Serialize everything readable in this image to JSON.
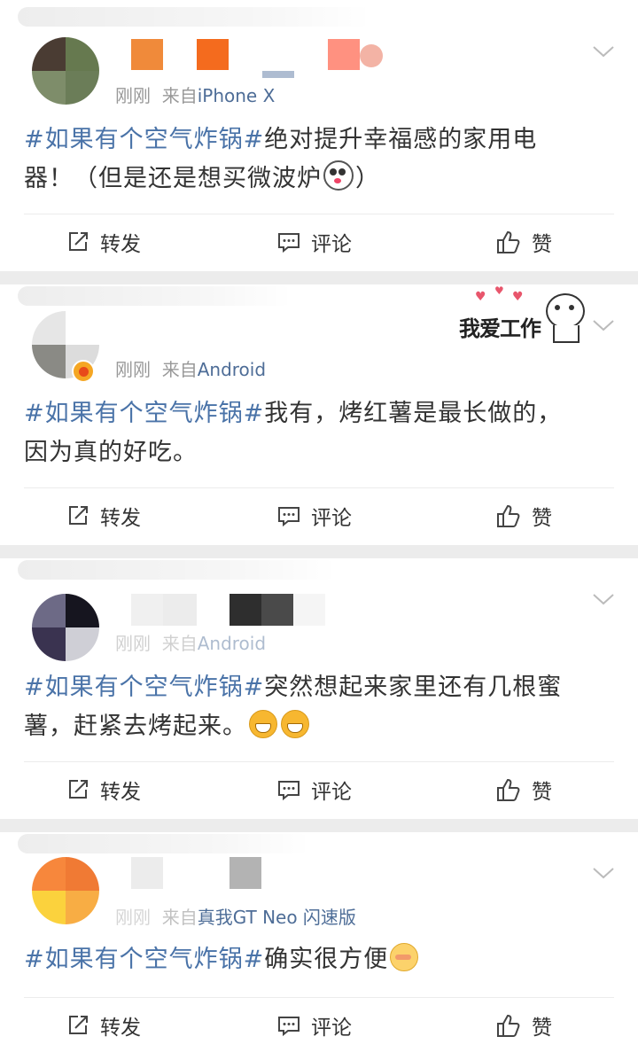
{
  "posts": [
    {
      "time": "刚刚",
      "source_prefix": "来自",
      "source": "iPhone X",
      "topic": "#如果有个空气炸锅#",
      "text_before_emoji": "绝对提升幸福感的家用电器！（但是还是想买微波炉",
      "emoji": [
        "panda-face-emoji"
      ],
      "text_after_emoji": "）"
    },
    {
      "time": "刚刚",
      "source_prefix": "来自",
      "source": "Android",
      "topic": "#如果有个空气炸锅#",
      "text": "我有，烤红薯是最长做的，因为真的好吃。",
      "badge": "verified-badge",
      "sticker_text": "我爱工作"
    },
    {
      "time": "刚刚",
      "source_prefix": "来自",
      "source": "Android",
      "topic": "#如果有个空气炸锅#",
      "text": "突然想起来家里还有几根蜜薯，赶紧去烤起来。",
      "emoji": [
        "grin-emoji",
        "grin-emoji"
      ]
    },
    {
      "time": "刚刚",
      "source_prefix": "来自",
      "source": "真我GT Neo 闪速版",
      "topic": "#如果有个空气炸锅#",
      "text": "确实很方便",
      "emoji": [
        "shy-face-emoji"
      ]
    }
  ],
  "actions": {
    "repost": "转发",
    "comment": "评论",
    "like": "赞"
  },
  "colors": {
    "topic_link": "#4a73a8",
    "source_link": "#4e6d97",
    "meta_gray": "#999999",
    "feed_bg": "#ececec"
  }
}
